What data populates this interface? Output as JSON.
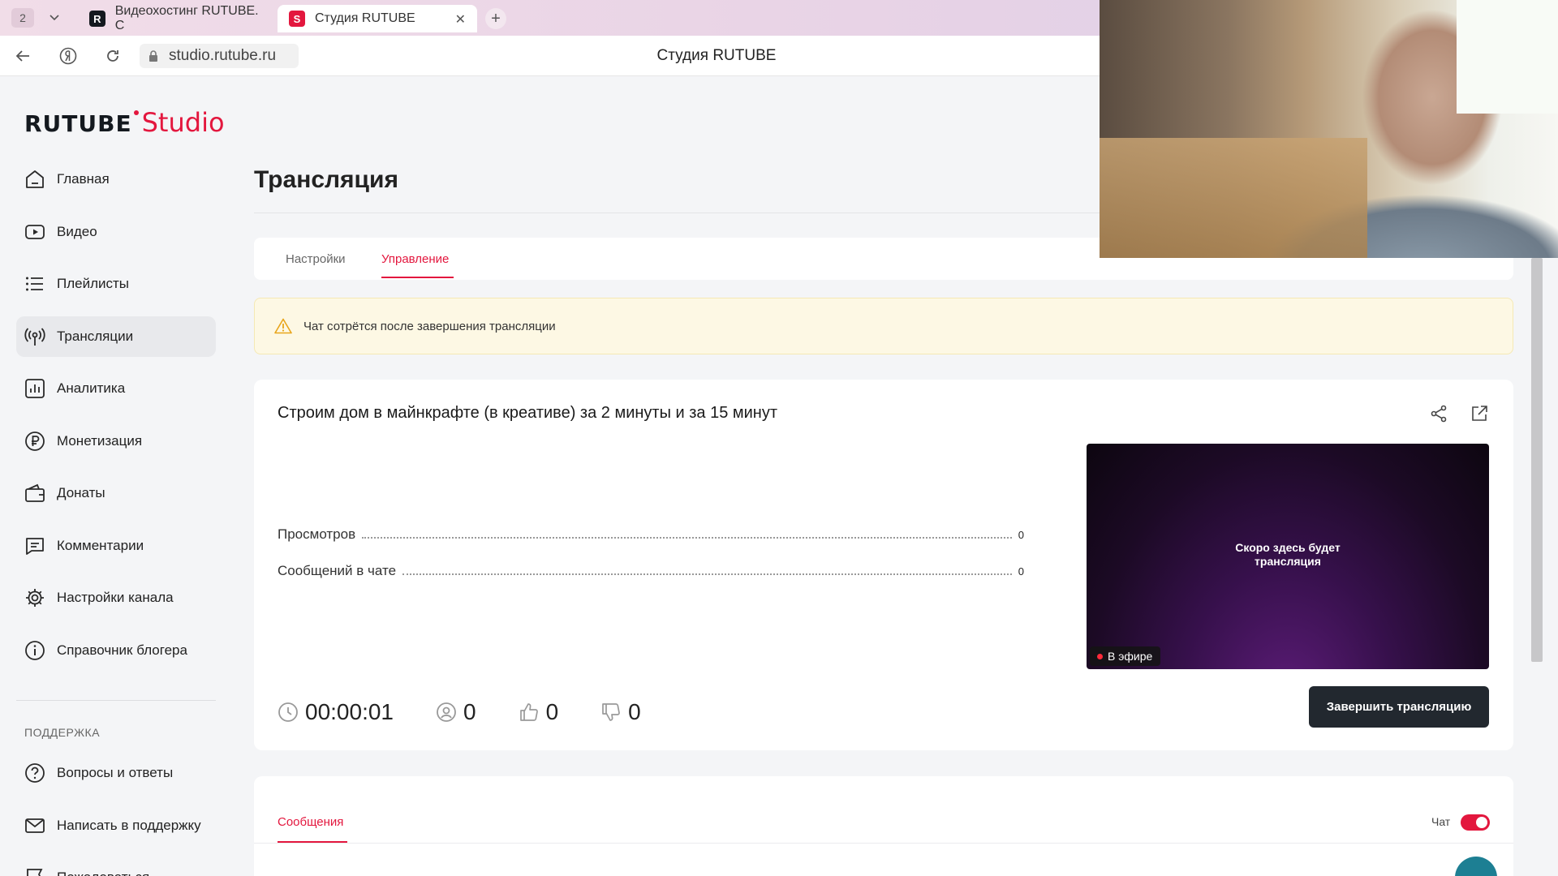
{
  "browser": {
    "tab_count": "2",
    "tabs": [
      {
        "label": "Видеохостинг RUTUBE. С",
        "favicon": "R"
      },
      {
        "label": "Студия RUTUBE",
        "favicon": "S"
      }
    ],
    "url": "studio.rutube.ru",
    "page_title": "Студия RUTUBE"
  },
  "logo": {
    "part1": "RUTUBE",
    "part2": "Studio",
    "accent": "#e3173e"
  },
  "sidebar": {
    "items": [
      {
        "label": "Главная",
        "icon": "home-icon"
      },
      {
        "label": "Видео",
        "icon": "video-icon"
      },
      {
        "label": "Плейлисты",
        "icon": "playlist-icon"
      },
      {
        "label": "Трансляции",
        "icon": "broadcast-icon",
        "active": true
      },
      {
        "label": "Аналитика",
        "icon": "analytics-icon"
      },
      {
        "label": "Монетизация",
        "icon": "ruble-icon"
      },
      {
        "label": "Донаты",
        "icon": "wallet-icon"
      },
      {
        "label": "Комментарии",
        "icon": "comment-icon"
      },
      {
        "label": "Настройки канала",
        "icon": "gear-icon"
      },
      {
        "label": "Справочник блогера",
        "icon": "info-icon"
      }
    ],
    "support_heading": "ПОДДЕРЖКА",
    "support_items": [
      {
        "label": "Вопросы и ответы",
        "icon": "question-icon"
      },
      {
        "label": "Написать в поддержку",
        "icon": "mail-icon"
      },
      {
        "label": "Пожаловаться",
        "icon": "flag-icon"
      }
    ]
  },
  "main": {
    "title": "Трансляция",
    "tabs": [
      {
        "label": "Настройки"
      },
      {
        "label": "Управление",
        "selected": true
      }
    ],
    "alert": "Чат сотрётся после завершения трансляции",
    "stream": {
      "title": "Строим дом в майнкрафте (в креативе) за 2 минуты и за 15 минут",
      "stats": [
        {
          "label": "Просмотров",
          "value": "0"
        },
        {
          "label": "Сообщений в чате",
          "value": "0"
        }
      ],
      "preview_text_1": "Скоро здесь будет",
      "preview_text_2": "трансляция",
      "live_label": "В эфире",
      "duration": "00:00:01",
      "viewers": "0",
      "likes": "0",
      "dislikes": "0",
      "end_button": "Завершить трансляцию"
    },
    "chat": {
      "tab_label": "Сообщения",
      "toggle_label": "Чат",
      "toggle_on": true
    }
  }
}
